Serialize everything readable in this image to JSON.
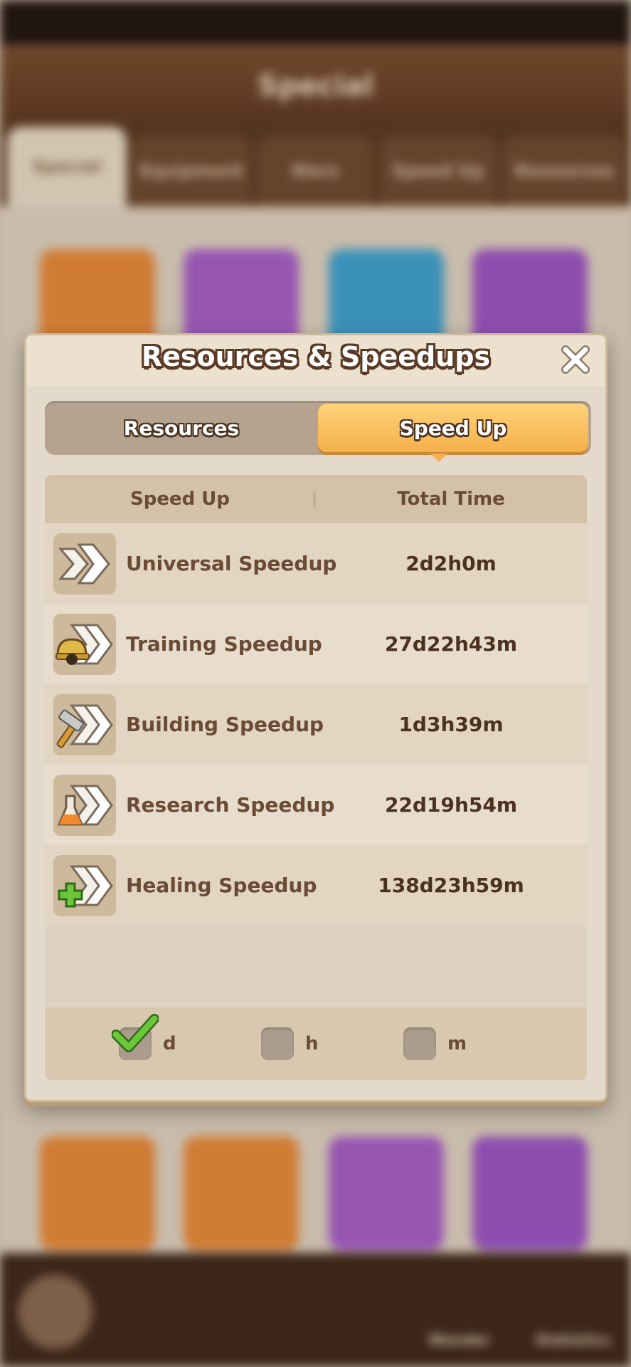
{
  "background": {
    "header_title": "Special",
    "tabs": [
      "Special",
      "Equipment",
      "Wars",
      "Speed Up",
      "Resources"
    ],
    "bottom_labels": [
      "Wonder",
      "Statistics"
    ]
  },
  "modal": {
    "title": "Resources & Speedups",
    "tabs": [
      {
        "label": "Resources",
        "active": false
      },
      {
        "label": "Speed Up",
        "active": true
      }
    ],
    "table": {
      "headers": [
        "Speed Up",
        "Total Time"
      ],
      "rows": [
        {
          "icon": "universal-speedup-icon",
          "name": "Universal Speedup",
          "time": "2d2h0m"
        },
        {
          "icon": "training-speedup-icon",
          "name": "Training Speedup",
          "time": "27d22h43m"
        },
        {
          "icon": "building-speedup-icon",
          "name": "Building Speedup",
          "time": "1d3h39m"
        },
        {
          "icon": "research-speedup-icon",
          "name": "Research Speedup",
          "time": "22d19h54m"
        },
        {
          "icon": "healing-speedup-icon",
          "name": "Healing Speedup",
          "time": "138d23h59m"
        }
      ]
    },
    "units": [
      {
        "label": "d",
        "checked": true
      },
      {
        "label": "h",
        "checked": false
      },
      {
        "label": "m",
        "checked": false
      }
    ]
  },
  "colors": {
    "accent": "#f4b04a",
    "outline": "#5a3a25",
    "text": "#6a4b35",
    "check": "#6cc63a"
  }
}
